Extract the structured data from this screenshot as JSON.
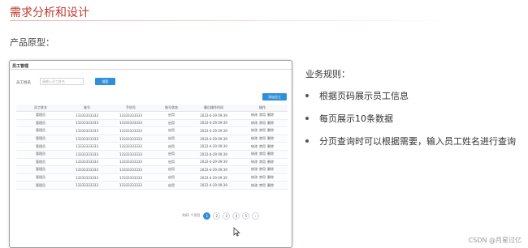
{
  "slide": {
    "title": "需求分析和设计",
    "subtitle": "产品原型：",
    "rules_title": "业务规则：",
    "rules": [
      "根据页码展示员工信息",
      "每页展示10条数据",
      "分页查询时可以根据需要，输入员工姓名进行查询"
    ],
    "watermark": "CSDN @月星过亿"
  },
  "prototype": {
    "header": "员工管理",
    "search_label": "员工姓名",
    "search_placeholder": "请输入员工姓名",
    "search_button": "搜索",
    "add_button": "添加员工",
    "columns": [
      "员工姓名",
      "账号",
      "手机号",
      "账号状态",
      "最后操作时间",
      "操作"
    ],
    "rows": [
      [
        "管理员",
        "13333333333",
        "13333333333",
        "启用",
        "2022-4-29 09:39",
        "修改",
        "禁用",
        "删除"
      ],
      [
        "管理员",
        "13333333333",
        "13333333333",
        "启用",
        "2022-4-29 09:39",
        "修改",
        "禁用",
        "删除"
      ],
      [
        "管理员",
        "13333333333",
        "13333333333",
        "启用",
        "2022-4-29 09:39",
        "修改",
        "禁用",
        "删除"
      ],
      [
        "管理员",
        "13333333333",
        "13333333333",
        "启用",
        "2022-4-29 09:39",
        "修改",
        "禁用",
        "删除"
      ],
      [
        "管理员",
        "13333333333",
        "13333333333",
        "启用",
        "2022-4-29 09:39",
        "修改",
        "禁用",
        "删除"
      ],
      [
        "管理员",
        "13333333333",
        "13333333333",
        "启用",
        "2022-4-29 09:39",
        "修改",
        "禁用",
        "删除"
      ],
      [
        "管理员",
        "13333333333",
        "13333333333",
        "启用",
        "2022-4-29 09:39",
        "修改",
        "禁用",
        "删除"
      ],
      [
        "管理员",
        "13333333333",
        "13333333333",
        "启用",
        "2022-4-29 09:39",
        "修改",
        "禁用",
        "删除"
      ],
      [
        "管理员",
        "13333333333",
        "13333333333",
        "启用",
        "2022-4-29 09:39",
        "修改",
        "禁用",
        "删除"
      ],
      [
        "管理员",
        "13333333333",
        "13333333333",
        "启用",
        "2022-4-29 09:39",
        "修改",
        "禁用",
        "删除"
      ]
    ],
    "pagination": {
      "total_text": "共85 个项目",
      "pages": [
        "1",
        "2",
        "3",
        "4",
        "5"
      ],
      "next": "›",
      "active_page": "1"
    }
  },
  "colors": {
    "title_red": "#c0392b",
    "primary_blue": "#2f8fd8"
  }
}
